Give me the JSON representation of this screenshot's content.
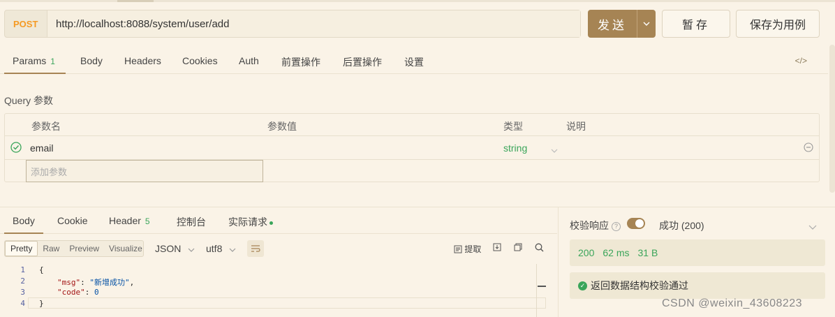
{
  "request": {
    "method": "POST",
    "url": "http://localhost:8088/system/user/add",
    "send_label": "发送",
    "save_label": "暂存",
    "save_case_label": "保存为用例"
  },
  "request_tabs": [
    {
      "label": "Params",
      "badge": "1",
      "active": true
    },
    {
      "label": "Body"
    },
    {
      "label": "Headers"
    },
    {
      "label": "Cookies"
    },
    {
      "label": "Auth"
    },
    {
      "label": "前置操作"
    },
    {
      "label": "后置操作"
    },
    {
      "label": "设置"
    }
  ],
  "code_toggle": "</>",
  "query": {
    "title": "Query 参数",
    "headers": {
      "name": "参数名",
      "value": "参数值",
      "type": "类型",
      "desc": "说明"
    },
    "rows": [
      {
        "name": "email",
        "value": "",
        "type": "string",
        "desc": ""
      }
    ],
    "add_placeholder": "添加参数"
  },
  "response_tabs": [
    {
      "label": "Body",
      "active": true
    },
    {
      "label": "Cookie"
    },
    {
      "label": "Header",
      "badge": "5"
    },
    {
      "label": "控制台"
    },
    {
      "label": "实际请求"
    }
  ],
  "format_options": [
    "Pretty",
    "Raw",
    "Preview",
    "Visualize"
  ],
  "format_selected": "Pretty",
  "lang_select": "JSON",
  "encoding_select": "utf8",
  "extract_label": "提取",
  "code_lines": [
    {
      "n": "1",
      "text": "{"
    },
    {
      "n": "2",
      "key": "\"msg\"",
      "val": "\"新增成功\"",
      "tail": ","
    },
    {
      "n": "3",
      "key": "\"code\"",
      "val": "0",
      "tail": ""
    },
    {
      "n": "4",
      "text": "}"
    }
  ],
  "verify": {
    "label": "校验响应",
    "help": "?",
    "enabled": true,
    "status": "成功 (200)"
  },
  "stats": {
    "code": "200",
    "time": "62 ms",
    "size": "31 B"
  },
  "verify_result": "返回数据结构校验通过",
  "watermark": "CSDN @weixin_43608223",
  "colors": {
    "accent": "#a68454",
    "success": "#3aa55a",
    "method": "#f59a23",
    "background": "#faf3e7"
  }
}
